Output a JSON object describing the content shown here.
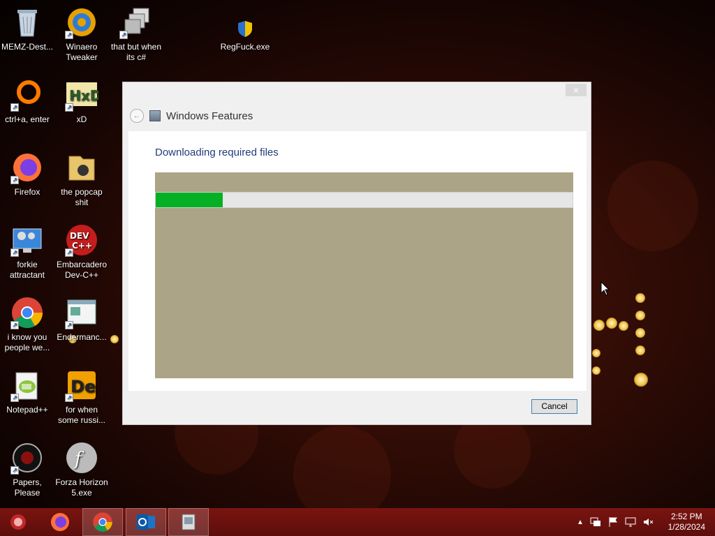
{
  "desktop": {
    "icons": [
      {
        "label": "MEMZ-Dest...",
        "icon": "recycle-bin-icon"
      },
      {
        "label": "Winaero Tweaker",
        "icon": "winaero-tweaker-icon"
      },
      {
        "label": "that but when its c#",
        "icon": "windows-stack-icon"
      },
      {
        "label": "RegFuck.exe",
        "icon": "uac-shield-icon"
      },
      {
        "label": "ctrl+a, enter",
        "icon": "orange-ring-icon"
      },
      {
        "label": "xD",
        "icon": "hxd-icon"
      },
      {
        "label": "Firefox",
        "icon": "firefox-icon"
      },
      {
        "label": "the popcap shit",
        "icon": "folder-icon"
      },
      {
        "label": "forkie attractant",
        "icon": "computer-gear-icon"
      },
      {
        "label": "Embarcadero Dev-C++",
        "icon": "dev-cpp-icon"
      },
      {
        "label": "i know you people we...",
        "icon": "chrome-icon"
      },
      {
        "label": "Endermanc...",
        "icon": "window-app-icon"
      },
      {
        "label": "Notepad++",
        "icon": "notepad-plus-plus-icon"
      },
      {
        "label": "for when some russi...",
        "icon": "de-icon"
      },
      {
        "label": "Papers, Please",
        "icon": "papers-please-icon"
      },
      {
        "label": "Forza Horizon 5.exe",
        "icon": "flash-icon"
      }
    ]
  },
  "dialog": {
    "title": "Windows Features",
    "heading": "Downloading required files",
    "progress_fraction": 0.16,
    "cancel_label": "Cancel",
    "close_symbol": "×",
    "back_symbol": "←"
  },
  "taskbar": {
    "items": [
      "start-orb-icon",
      "firefox-icon",
      "chrome-icon",
      "outlook-icon",
      "windows-features-icon"
    ],
    "tray_icons": [
      "tray-chevron-icon",
      "network-icon",
      "flag-icon",
      "display-icon",
      "volume-muted-icon"
    ],
    "time": "2:52 PM",
    "date": "1/28/2024"
  },
  "colors": {
    "progress_fill": "#06b025",
    "heading": "#1f3c7a",
    "taskbar": "#6b110e"
  }
}
